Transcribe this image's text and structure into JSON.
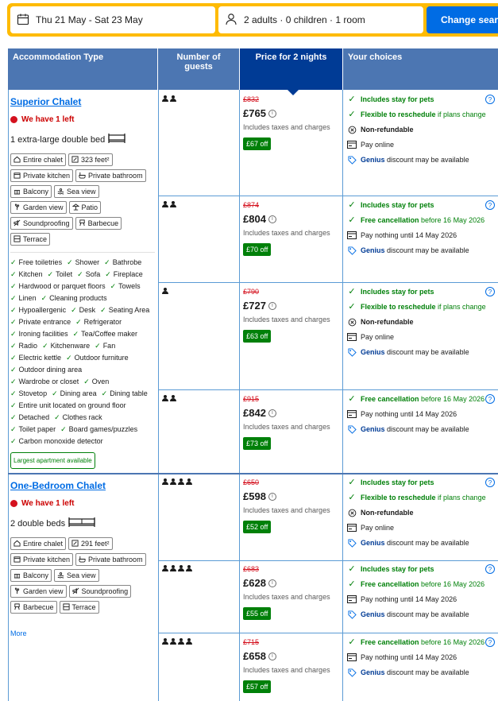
{
  "search": {
    "dates": "Thu 21 May - Sat 23 May",
    "guests": "2 adults · 0 children · 1 room",
    "button": "Change search"
  },
  "table_header": {
    "accommodation": "Accommodation Type",
    "guests": "Number of guests",
    "price": "Price for 2 nights",
    "choices": "Your choices"
  },
  "rooms": [
    {
      "name": "Superior Chalet",
      "availability": "We have 1 left",
      "bed": "1 extra-large double bed",
      "tags": [
        "Entire chalet",
        "323 feet²",
        "Private kitchen",
        "Private bathroom",
        "Balcony",
        "Sea view",
        "Garden view",
        "Patio",
        "Soundproofing",
        "Barbecue",
        "Terrace"
      ],
      "facilities": [
        "Free toiletries",
        "Shower",
        "Bathrobe",
        "Kitchen",
        "Toilet",
        "Sofa",
        "Fireplace",
        "Hardwood or parquet floors",
        "Towels",
        "Linen",
        "Cleaning products",
        "Hypoallergenic",
        "Desk",
        "Seating Area",
        "Private entrance",
        "Refrigerator",
        "Ironing facilities",
        "Tea/Coffee maker",
        "Radio",
        "Kitchenware",
        "Fan",
        "Electric kettle",
        "Outdoor furniture",
        "Outdoor dining area",
        "Wardrobe or closet",
        "Oven",
        "Stovetop",
        "Dining area",
        "Dining table",
        "Entire unit located on ground floor",
        "Detached",
        "Clothes rack",
        "Toilet paper",
        "Board games/puzzles",
        "Carbon monoxide detector"
      ],
      "highlight": "Largest apartment available"
    },
    {
      "name": "One-Bedroom Chalet",
      "availability": "We have 1 left",
      "bed": "2 double beds",
      "tags": [
        "Entire chalet",
        "291 feet²",
        "Private kitchen",
        "Private bathroom",
        "Balcony",
        "Sea view",
        "Garden view",
        "Soundproofing",
        "Barbecue",
        "Terrace"
      ],
      "more": "More"
    }
  ],
  "options": [
    {
      "guests": 2,
      "old_price": "£832",
      "price": "£765",
      "taxes": "Includes taxes and charges",
      "discount": "£67 off",
      "choices": [
        {
          "icon": "check",
          "strong": "Includes stay for pets",
          "rest": ""
        },
        {
          "icon": "check",
          "strong": "Flexible to reschedule",
          "rest": " if plans change"
        },
        {
          "icon": "non-refundable",
          "strong": "Non-refundable",
          "rest": ""
        },
        {
          "icon": "card",
          "strong": "",
          "rest": "Pay online"
        },
        {
          "icon": "tag",
          "strong": "Genius",
          "rest": " discount may be available"
        }
      ]
    },
    {
      "guests": 2,
      "old_price": "£874",
      "price": "£804",
      "taxes": "Includes taxes and charges",
      "discount": "£70 off",
      "choices": [
        {
          "icon": "check",
          "strong": "Includes stay for pets",
          "rest": ""
        },
        {
          "icon": "check",
          "strong": "Free cancellation",
          "rest": " before 16 May 2026"
        },
        {
          "icon": "card",
          "strong": "",
          "rest": "Pay nothing until 14 May 2026"
        },
        {
          "icon": "tag",
          "strong": "Genius",
          "rest": " discount may be available"
        }
      ]
    },
    {
      "guests": 1,
      "old_price": "£790",
      "price": "£727",
      "taxes": "Includes taxes and charges",
      "discount": "£63 off",
      "choices": [
        {
          "icon": "check",
          "strong": "Includes stay for pets",
          "rest": ""
        },
        {
          "icon": "check",
          "strong": "Flexible to reschedule",
          "rest": " if plans change"
        },
        {
          "icon": "non-refundable",
          "strong": "Non-refundable",
          "rest": ""
        },
        {
          "icon": "card",
          "strong": "",
          "rest": "Pay online"
        },
        {
          "icon": "tag",
          "strong": "Genius",
          "rest": " discount may be available"
        }
      ]
    },
    {
      "guests": 2,
      "old_price": "£915",
      "price": "£842",
      "taxes": "Includes taxes and charges",
      "discount": "£73 off",
      "choices": [
        {
          "icon": "check",
          "strong": "Free cancellation",
          "rest": " before 16 May 2026"
        },
        {
          "icon": "card",
          "strong": "",
          "rest": "Pay nothing until 14 May 2026"
        },
        {
          "icon": "tag",
          "strong": "Genius",
          "rest": " discount may be available"
        }
      ]
    },
    {
      "guests": 4,
      "old_price": "£650",
      "price": "£598",
      "taxes": "Includes taxes and charges",
      "discount": "£52 off",
      "choices": [
        {
          "icon": "check",
          "strong": "Includes stay for pets",
          "rest": ""
        },
        {
          "icon": "check",
          "strong": "Flexible to reschedule",
          "rest": " if plans change"
        },
        {
          "icon": "non-refundable",
          "strong": "Non-refundable",
          "rest": ""
        },
        {
          "icon": "card",
          "strong": "",
          "rest": "Pay online"
        },
        {
          "icon": "tag",
          "strong": "Genius",
          "rest": " discount may be available"
        }
      ]
    },
    {
      "guests": 4,
      "old_price": "£683",
      "price": "£628",
      "taxes": "Includes taxes and charges",
      "discount": "£55 off",
      "choices": [
        {
          "icon": "check",
          "strong": "Includes stay for pets",
          "rest": ""
        },
        {
          "icon": "check",
          "strong": "Free cancellation",
          "rest": " before 16 May 2026"
        },
        {
          "icon": "card",
          "strong": "",
          "rest": "Pay nothing until 14 May 2026"
        },
        {
          "icon": "tag",
          "strong": "Genius",
          "rest": " discount may be available"
        }
      ]
    },
    {
      "guests": 4,
      "old_price": "£715",
      "price": "£658",
      "taxes": "Includes taxes and charges",
      "discount": "£57 off",
      "choices": [
        {
          "icon": "check",
          "strong": "Free cancellation",
          "rest": " before 16 May 2026"
        },
        {
          "icon": "card",
          "strong": "",
          "rest": "Pay nothing until 14 May 2026"
        },
        {
          "icon": "tag",
          "strong": "Genius",
          "rest": " discount may be available"
        }
      ]
    }
  ]
}
